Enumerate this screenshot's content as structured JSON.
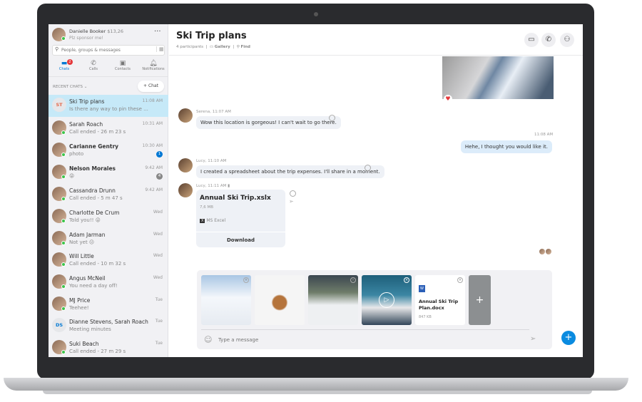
{
  "profile": {
    "name": "Danielle Booker",
    "credit": "$13,26",
    "mood": "Plz sponsor me!"
  },
  "search": {
    "placeholder": "People, groups & messages"
  },
  "nav": [
    {
      "label": "Chats",
      "badge": "2"
    },
    {
      "label": "Calls"
    },
    {
      "label": "Contacts"
    },
    {
      "label": "Notifications"
    }
  ],
  "recent_label": "RECENT CHATS",
  "new_chat": "+ Chat",
  "chats": [
    {
      "name": "Ski Trip plans",
      "preview": "Is there any way to pin these ...",
      "time": "11:08 AM",
      "initials": "ST",
      "selected": true
    },
    {
      "name": "Sarah Roach",
      "preview": "Call ended - 26 m 23 s",
      "time": "10:31 AM"
    },
    {
      "name": "Carianne Gentry",
      "preview": "photo",
      "time": "10:30 AM",
      "bold": true,
      "badge": "1"
    },
    {
      "name": "Nelson Morales",
      "preview": "😝",
      "time": "9:42 AM",
      "bold": true,
      "badge": "4"
    },
    {
      "name": "Cassandra Drunn",
      "preview": "Call ended - 5 m 47 s",
      "time": "9:42 AM"
    },
    {
      "name": "Charlotte De Crum",
      "preview": "Told you!! 😜",
      "time": "Wed"
    },
    {
      "name": "Adam Jarman",
      "preview": "Not yet 😐",
      "time": "Wed"
    },
    {
      "name": "Will Little",
      "preview": "Call ended - 10 m 32 s",
      "time": "Wed"
    },
    {
      "name": "Angus McNeil",
      "preview": "You need a day off!",
      "time": "Wed"
    },
    {
      "name": "MJ Price",
      "preview": "Teehee!",
      "time": "Tue"
    },
    {
      "name": "Dianne Stevens, Sarah Roach",
      "preview": "Meeting minutes",
      "time": "Tue",
      "initials": "DS"
    },
    {
      "name": "Suki Beach",
      "preview": "Call ended - 27 m 29 s",
      "time": "Tue"
    }
  ],
  "conversation": {
    "title": "Ski Trip plans",
    "participants": "4 participants",
    "gallery": "Gallery",
    "find": "Find"
  },
  "messages": [
    {
      "meta": "Serena, 11:07 AM",
      "text": "Wow this location is gorgeous! I can't wait to go there."
    },
    {
      "meta": "11:08 AM",
      "text": "Hehe, I thought you would like it."
    },
    {
      "meta": "Lucy, 11:10 AM",
      "text": "I created a spreadsheet about the trip expenses. I'll share in a moment."
    },
    {
      "meta": "Lucy, 11:11 AM",
      "file": {
        "name": "Annual Ski Trip.xslx",
        "size": "7,6 MB",
        "type": "MS Excel",
        "action": "Download"
      }
    }
  ],
  "attachments": {
    "doc_name": "Annual Ski Trip Plan.docx",
    "doc_size": "847 KB"
  },
  "composer": {
    "placeholder": "Type a message"
  },
  "colors": {
    "accent": "#0078d4",
    "selected": "#c6e9f8",
    "online": "#3cc44a"
  }
}
